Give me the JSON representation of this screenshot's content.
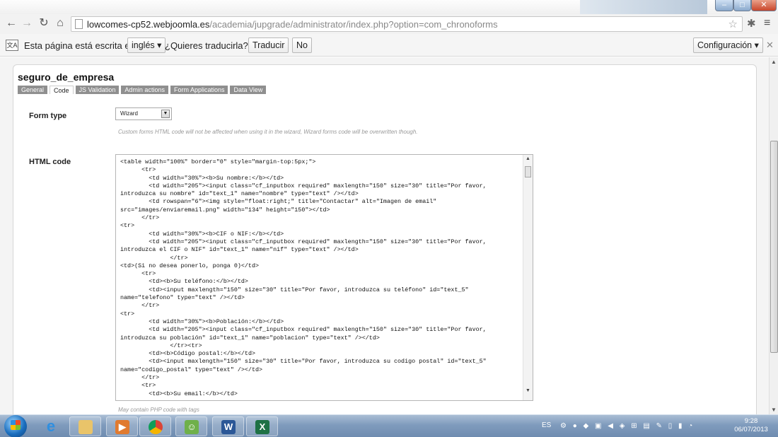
{
  "browser": {
    "url_host": "lowcomes-cp52.webjoomla.es",
    "url_path": "/academia/jupgrade/administrator/index.php?option=com_chronoforms"
  },
  "translate_bar": {
    "message": "Esta página está escrita en",
    "language": "inglés",
    "question": "¿Quieres traducirla?",
    "translate_label": "Traducir",
    "no_label": "No",
    "settings_label": "Configuración"
  },
  "form": {
    "title": "seguro_de_empresa",
    "tabs": [
      "General",
      "Code",
      "JS Validation",
      "Admin actions",
      "Form Applications",
      "Data View"
    ],
    "active_tab": "Code",
    "form_type_label": "Form type",
    "form_type_value": "Wizard",
    "form_type_note": "Custom forms HTML code will not be affected when using it in the wizard, Wizard forms code will be overwritten though.",
    "html_code_label": "HTML code",
    "html_code": "<table width=\"100%\" border=\"0\" style=\"margin-top:5px;\">\n      <tr>\n        <td width=\"30%\"><b>Su nombre:</b></td>\n        <td width=\"205\"><input class=\"cf_inputbox required\" maxlength=\"150\" size=\"30\" title=\"Por favor, introduzca su nombre\" id=\"text_1\" name=\"nombre\" type=\"text\" /></td>\n        <td rowspan=\"6\"><img style=\"float:right;\" title=\"Contactar\" alt=\"Imagen de email\" src=\"images/enviaremail.png\" width=\"134\" height=\"150\"></td>\n      </tr>\n<tr>\n        <td width=\"30%\"><b>CIF o NIF:</b></td>\n        <td width=\"205\"><input class=\"cf_inputbox required\" maxlength=\"150\" size=\"30\" title=\"Por favor, introduzca el CIF o NIF\" id=\"text_1\" name=\"nif\" type=\"text\" /></td>\n              </tr>\n<td>(Si no desea ponerlo, ponga 0)</td>\n      <tr>\n        <td><b>Su teléfono:</b></td>\n        <td><input maxlength=\"150\" size=\"30\" title=\"Por favor, introduzca su teléfono\" id=\"text_5\" name=\"telefono\" type=\"text\" /></td>\n      </tr>\n<tr>\n        <td width=\"30%\"><b>Población:</b></td>\n        <td width=\"205\"><input class=\"cf_inputbox required\" maxlength=\"150\" size=\"30\" title=\"Por favor, introduzca su población\" id=\"text_1\" name=\"poblacion\" type=\"text\" /></td>\n              </tr><tr>\n        <td><b>Código postal:</b></td>\n        <td><input maxlength=\"150\" size=\"30\" title=\"Por favor, introduzca su codigo postal\" id=\"text_5\" name=\"codigo_postal\" type=\"text\" /></td>\n      </tr>\n      <tr>\n        <td><b>Su email:</b></td>",
    "html_code_note": "May contain PHP code with tags"
  },
  "taskbar": {
    "apps": [
      "windows-explorer",
      "internet-explorer",
      "file-explorer",
      "media-player",
      "chrome",
      "people",
      "word",
      "excel"
    ],
    "tray_language": "ES",
    "time": "9:28",
    "date": "06/07/2013"
  },
  "colors": {
    "tab_inactive": "#8f8f8f",
    "taskbar": "#7f9bbd",
    "close_button": "#c9462b"
  }
}
